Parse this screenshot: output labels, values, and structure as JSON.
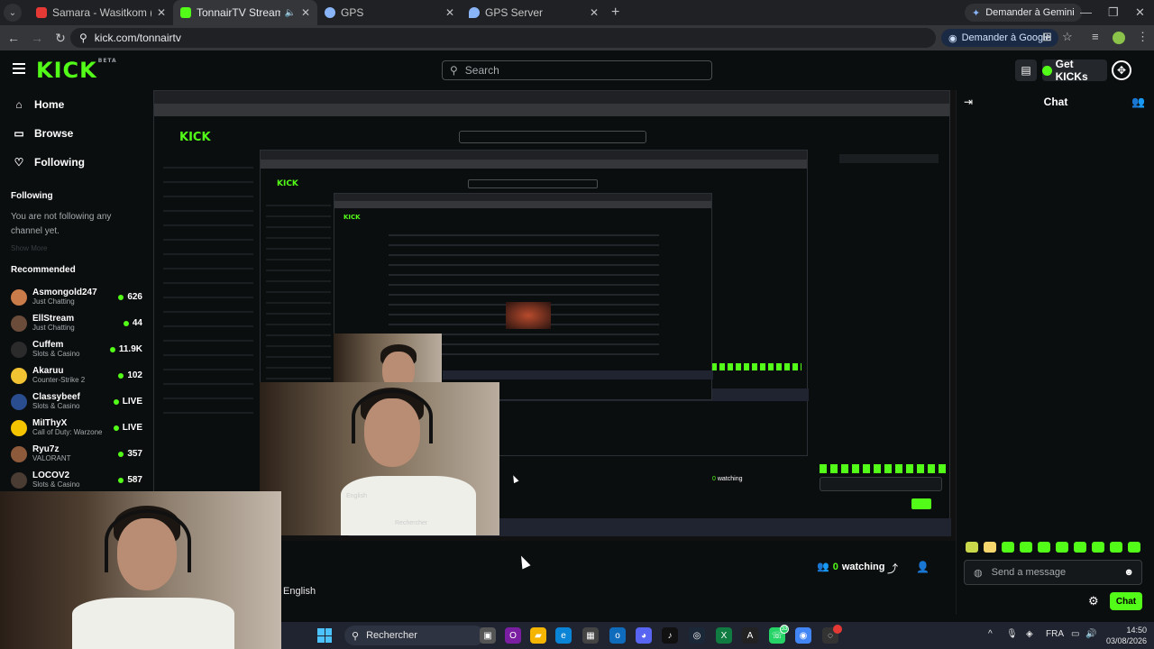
{
  "browser": {
    "tabs": [
      {
        "label": "Samara - Wasitkom (Official M",
        "fav_color": "#e53935",
        "active": false
      },
      {
        "label": "TonnairTV Stream - Watch L",
        "fav_color": "#53fc18",
        "active": true
      },
      {
        "label": "GPS",
        "fav_color": "#8ab4f8",
        "active": false
      },
      {
        "label": "GPS Server",
        "fav_color": "#8ab4f8",
        "active": false
      }
    ],
    "gemini_label": "Demander à Gemini",
    "url": "kick.com/tonnairtv",
    "ask_google_label": "Demander à Google"
  },
  "header": {
    "logo": "KICK",
    "logo_sup": "BETA",
    "search_placeholder": "Search",
    "get_kicks_label": "Get KICKs"
  },
  "sidebar": {
    "nav": [
      {
        "label": "Home",
        "icon": "home-icon"
      },
      {
        "label": "Browse",
        "icon": "browse-icon"
      },
      {
        "label": "Following",
        "icon": "heart-icon"
      }
    ],
    "following_title": "Following",
    "following_empty": "You are not following any channel yet.",
    "show_more": "Show More",
    "recommended_title": "Recommended",
    "recommended": [
      {
        "name": "Asmongold247",
        "category": "Just Chatting",
        "viewers": "626",
        "avatar_color": "#c97b4a"
      },
      {
        "name": "EllStream",
        "category": "Just Chatting",
        "viewers": "44",
        "avatar_color": "#6b4c3b"
      },
      {
        "name": "Cuffem",
        "category": "Slots & Casino",
        "viewers": "11.9K",
        "avatar_color": "#2b2b2b"
      },
      {
        "name": "Akaruu",
        "category": "Counter-Strike 2",
        "viewers": "102",
        "avatar_color": "#f1c232"
      },
      {
        "name": "Classybeef",
        "category": "Slots & Casino",
        "viewers": "LIVE",
        "avatar_color": "#2a4d8f"
      },
      {
        "name": "MiIThyX",
        "category": "Call of Duty: Warzone",
        "viewers": "LIVE",
        "avatar_color": "#f5c400"
      },
      {
        "name": "Ryu7z",
        "category": "VALORANT",
        "viewers": "357",
        "avatar_color": "#8d5a3b"
      },
      {
        "name": "LOCOV2",
        "category": "Slots & Casino",
        "viewers": "587",
        "avatar_color": "#4a3b33"
      }
    ]
  },
  "stream": {
    "watching_count": "0",
    "watching_label": "watching",
    "language": "English"
  },
  "chat": {
    "title": "Chat",
    "input_placeholder": "Send a message",
    "send_label": "Chat"
  },
  "taskbar": {
    "search_label": "Rechercher",
    "lang": "FRA",
    "time": "14:50",
    "date": "03/08/2026",
    "whatsapp_badge": "33"
  },
  "colors": {
    "accent": "#53fc18",
    "background": "#0b0e0f"
  }
}
